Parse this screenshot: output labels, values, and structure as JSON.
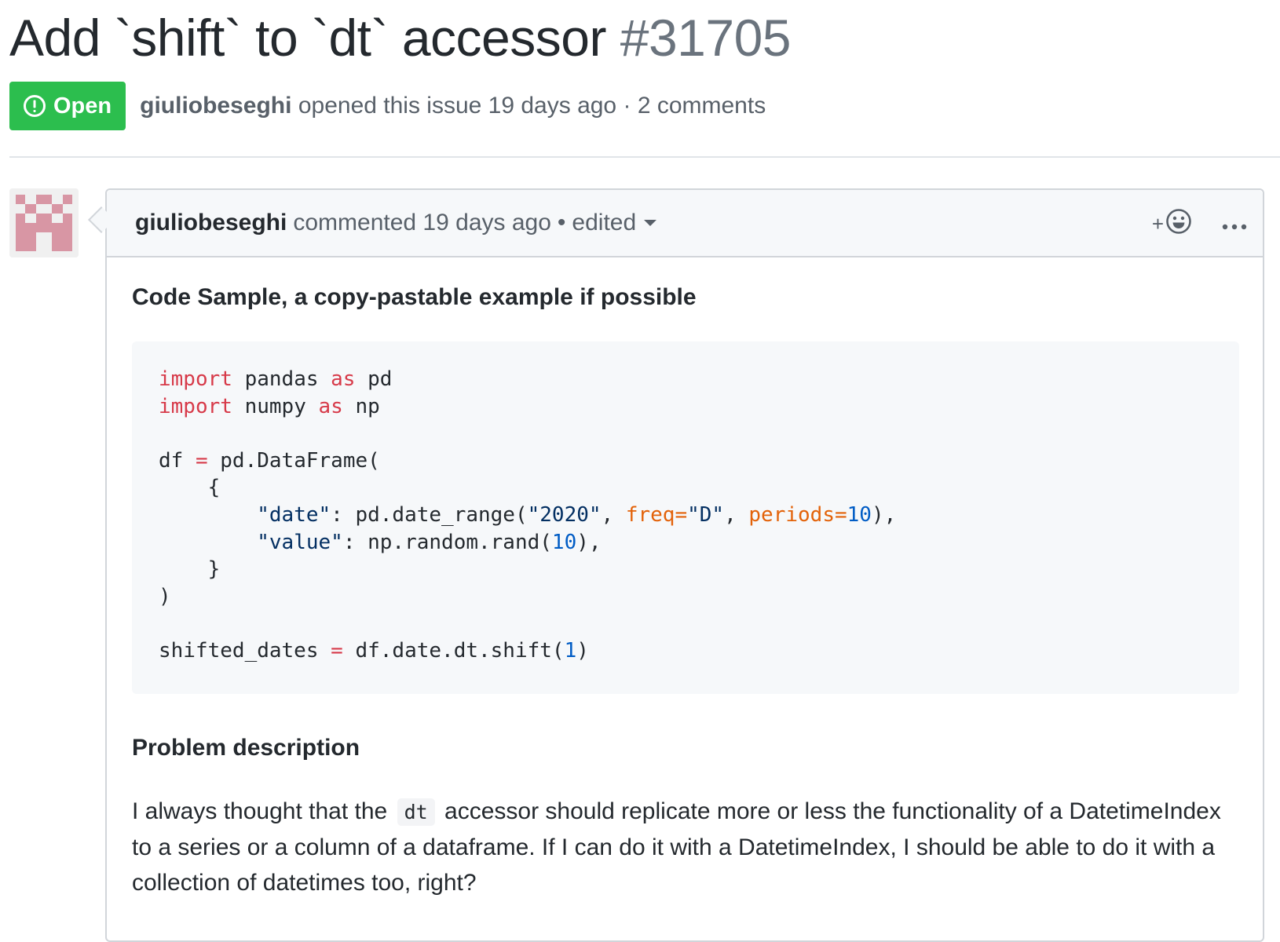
{
  "issue": {
    "title": "Add `shift` to `dt` accessor",
    "number": "#31705",
    "state": "Open",
    "author": "giuliobeseghi",
    "opened_text": "opened this issue 19 days ago",
    "separator": "·",
    "comments_count": "2 comments"
  },
  "comment": {
    "author": "giuliobeseghi",
    "commented_text": "commented 19 days ago",
    "bullet": "•",
    "edited_label": "edited",
    "add_reaction_label": "+",
    "code_sample_heading": "Code Sample, a copy-pastable example if possible",
    "code": {
      "line1": {
        "kw1": "import",
        "mod": "pandas",
        "kw2": "as",
        "alias": "pd"
      },
      "line2": {
        "kw1": "import",
        "mod": "numpy",
        "kw2": "as",
        "alias": "np"
      },
      "line4": {
        "lhs": "df",
        "op": "=",
        "call": "pd.DataFrame("
      },
      "line5": {
        "text": "{"
      },
      "line6": {
        "key": "\"date\"",
        "mid": ": pd.date_range(",
        "arg1": "\"2020\"",
        "comma1": ", ",
        "kw_freq": "freq=",
        "val_freq": "\"D\"",
        "comma2": ", ",
        "kw_periods": "periods=",
        "val_periods": "10",
        "end": "),"
      },
      "line7": {
        "key": "\"value\"",
        "mid": ": np.random.rand(",
        "num": "10",
        "end": "),"
      },
      "line8": {
        "text": "}"
      },
      "line9": {
        "text": ")"
      },
      "line11": {
        "lhs": "shifted_dates",
        "op": "=",
        "call": "df.date.dt.shift(",
        "num": "1",
        "end": ")"
      }
    },
    "problem_heading": "Problem description",
    "paragraph": {
      "before_code": "I always thought that the",
      "inline_code": "dt",
      "after_code": "accessor should replicate more or less the functionality of a DatetimeIndex to a series or a column of a dataframe. If I can do it with a DatetimeIndex, I should be able to do it with a collection of datetimes too, right?"
    }
  },
  "colors": {
    "open_badge": "#2cbe4e",
    "code_keyword": "#d73a49",
    "code_string": "#032f62",
    "code_number": "#005cc5",
    "code_param": "#e36209",
    "avatar_pink": "#d896a4"
  },
  "icons": {
    "state": "issue-opened-icon",
    "reaction": "smiley-icon",
    "more": "kebab-horizontal-icon",
    "edited": "caret-down-icon"
  }
}
